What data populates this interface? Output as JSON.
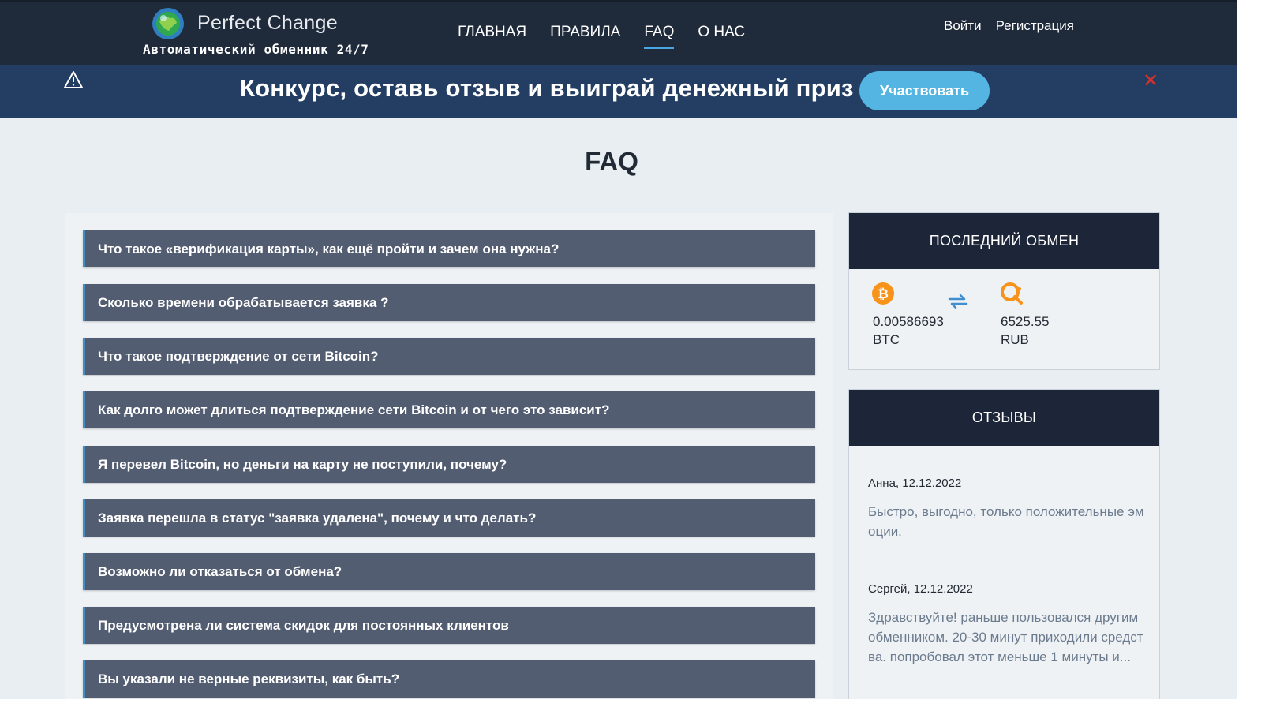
{
  "header": {
    "brand_name": "Perfect Change",
    "tagline": "Автоматический обменник 24/7",
    "nav": [
      {
        "label": "ГЛАВНАЯ",
        "active": false
      },
      {
        "label": "ПРАВИЛА",
        "active": false
      },
      {
        "label": "FAQ",
        "active": true
      },
      {
        "label": "О НАС",
        "active": false
      }
    ],
    "login_label": "Войти",
    "register_label": "Регистрация"
  },
  "banner": {
    "text": "Конкурс, оставь отзыв и выиграй денежный приз",
    "button_label": "Участвовать",
    "close_symbol": "✕"
  },
  "page_title": "FAQ",
  "faq": [
    "Что такое «верификация карты», как ещё пройти и зачем она нужна?",
    "Сколько времени обрабатывается заявка ?",
    "Что такое подтверждение от сети Bitcoin?",
    "Как долго может длиться подтверждение сети Bitcoin и от чего это зависит?",
    "Я перевел Bitcoin, но деньги на карту не поступили, почему?",
    "Заявка перешла в статус \"заявка удалена\", почему и что делать?",
    "Возможно ли отказаться от обмена?",
    "Предусмотрена ли система скидок для постоянных клиентов",
    "Вы указали не верные реквизиты, как быть?"
  ],
  "last_exchange": {
    "title": "ПОСЛЕДНИЙ ОБМЕН",
    "from_amount": "0.00586693",
    "from_currency": "BTC",
    "to_amount": "6525.55",
    "to_currency": "RUB"
  },
  "reviews": {
    "title": "ОТЗЫВЫ",
    "items": [
      {
        "author": "Анна, 12.12.2022",
        "text": "Быстро, выгодно, только положительные эмоции."
      },
      {
        "author": "Сергей, 12.12.2022",
        "text": "Здравствуйте! раньше пользовался другим обменником. 20-30 минут приходили средства. попробовал этот меньше 1 минуты и..."
      }
    ]
  },
  "colors": {
    "header_bg": "#1f2a3a",
    "banner_bg": "#233d63",
    "accent": "#54b4e2",
    "faq_item_bg": "#535d71",
    "widget_head_bg": "#1d2639",
    "close_red": "#d9302a",
    "bitcoin_orange": "#f7931a"
  }
}
